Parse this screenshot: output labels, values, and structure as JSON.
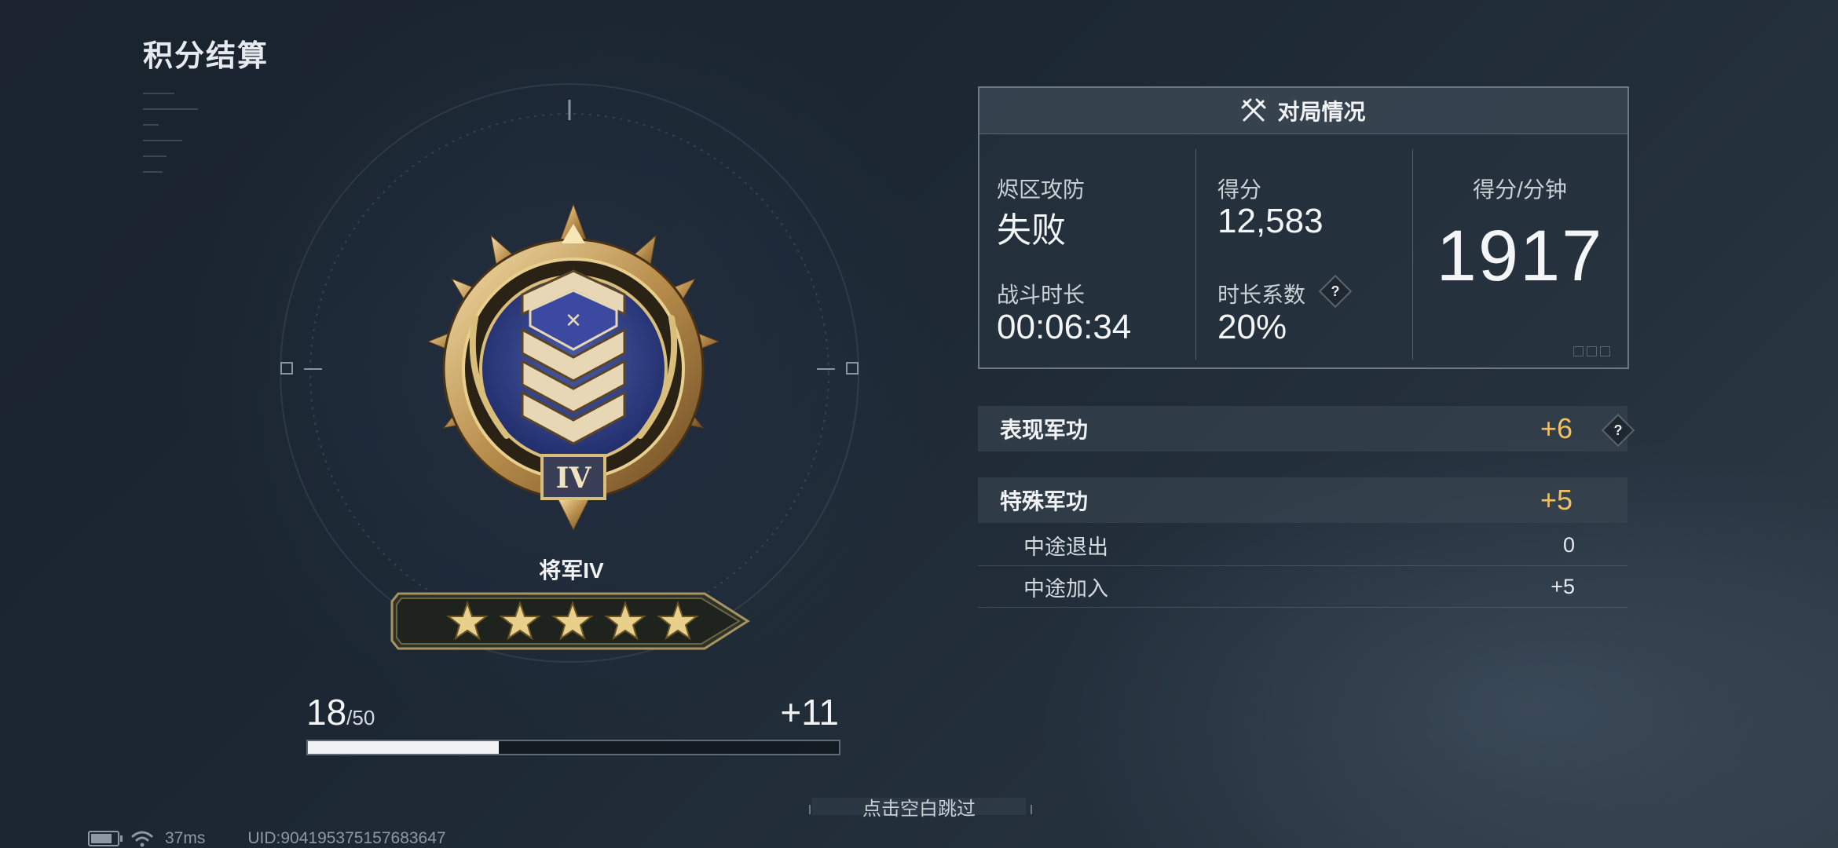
{
  "page": {
    "title": "积分结算"
  },
  "rank": {
    "name": "将军IV",
    "numeral": "IV",
    "stars": 5
  },
  "progress": {
    "current": "18",
    "max": "/50",
    "gain": "+11",
    "fraction": 0.36
  },
  "match": {
    "header": "对局情况",
    "mode_label": "烬区攻防",
    "mode_result": "失败",
    "score_label": "得分",
    "score_value": "12,583",
    "duration_label": "战斗时长",
    "duration_value": "00:06:34",
    "coef_label": "时长系数",
    "coef_value": "20%",
    "spm_label": "得分/分钟",
    "spm_value": "1917",
    "help": "?"
  },
  "merit": {
    "performance": {
      "label": "表现军功",
      "value": "+6"
    },
    "special": {
      "label": "特殊军功",
      "value": "+5"
    },
    "items": [
      {
        "label": "中途退出",
        "value": "0"
      },
      {
        "label": "中途加入",
        "value": "+5"
      }
    ]
  },
  "hint": {
    "skip": "点击空白跳过"
  },
  "status": {
    "ping": "37ms",
    "uid": "UID:904195375157683647"
  },
  "colors": {
    "accent_gold": "#f2c063",
    "panel_border": "#6c7884"
  }
}
